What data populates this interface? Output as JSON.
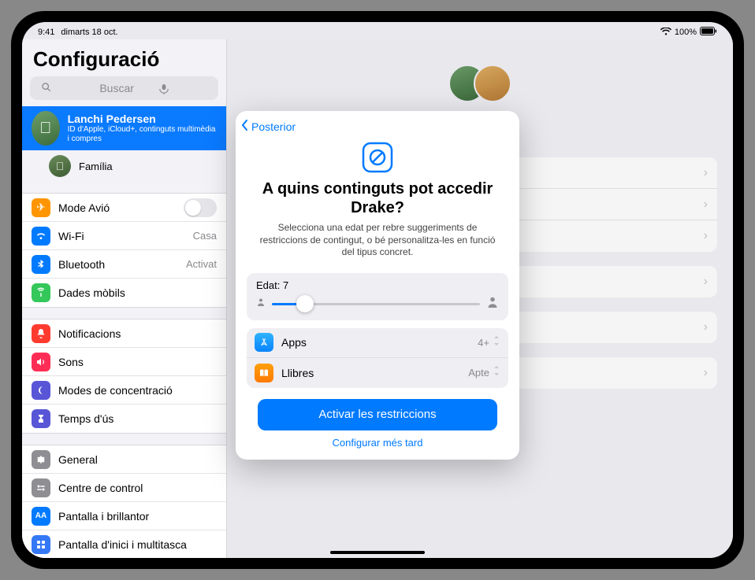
{
  "status": {
    "time": "9:41",
    "date": "dimarts 18 oct.",
    "battery": "100%"
  },
  "app_title": "Configuració",
  "search": {
    "placeholder": "Buscar"
  },
  "account": {
    "name": "Lanchi Pedersen",
    "sub": "ID d'Apple, iCloud+, continguts multimèdia i compres",
    "family_label": "Família"
  },
  "sidebar": {
    "airplane": "Mode Avió",
    "wifi": "Wi-Fi",
    "wifi_value": "Casa",
    "bluetooth": "Bluetooth",
    "bluetooth_value": "Activat",
    "cellular": "Dades mòbils",
    "notifications": "Notificacions",
    "sounds": "Sons",
    "focus": "Modes de concentració",
    "screentime": "Temps d'ús",
    "general": "General",
    "control": "Centre de control",
    "display": "Pantalla i brillantor",
    "home": "Pantalla d'inici i multitasca"
  },
  "modal": {
    "back": "Posterior",
    "title": "A quins continguts pot accedir Drake?",
    "desc": "Selecciona una edat per rebre suggeriments de restriccions de contingut, o bé personalitza-les en funció del tipus concret.",
    "age_label": "Edat: 7",
    "apps_label": "Apps",
    "apps_value": "4+",
    "books_label": "Llibres",
    "books_value": "Apte",
    "primary": "Activar les restriccions",
    "later": "Configurar més tard"
  }
}
